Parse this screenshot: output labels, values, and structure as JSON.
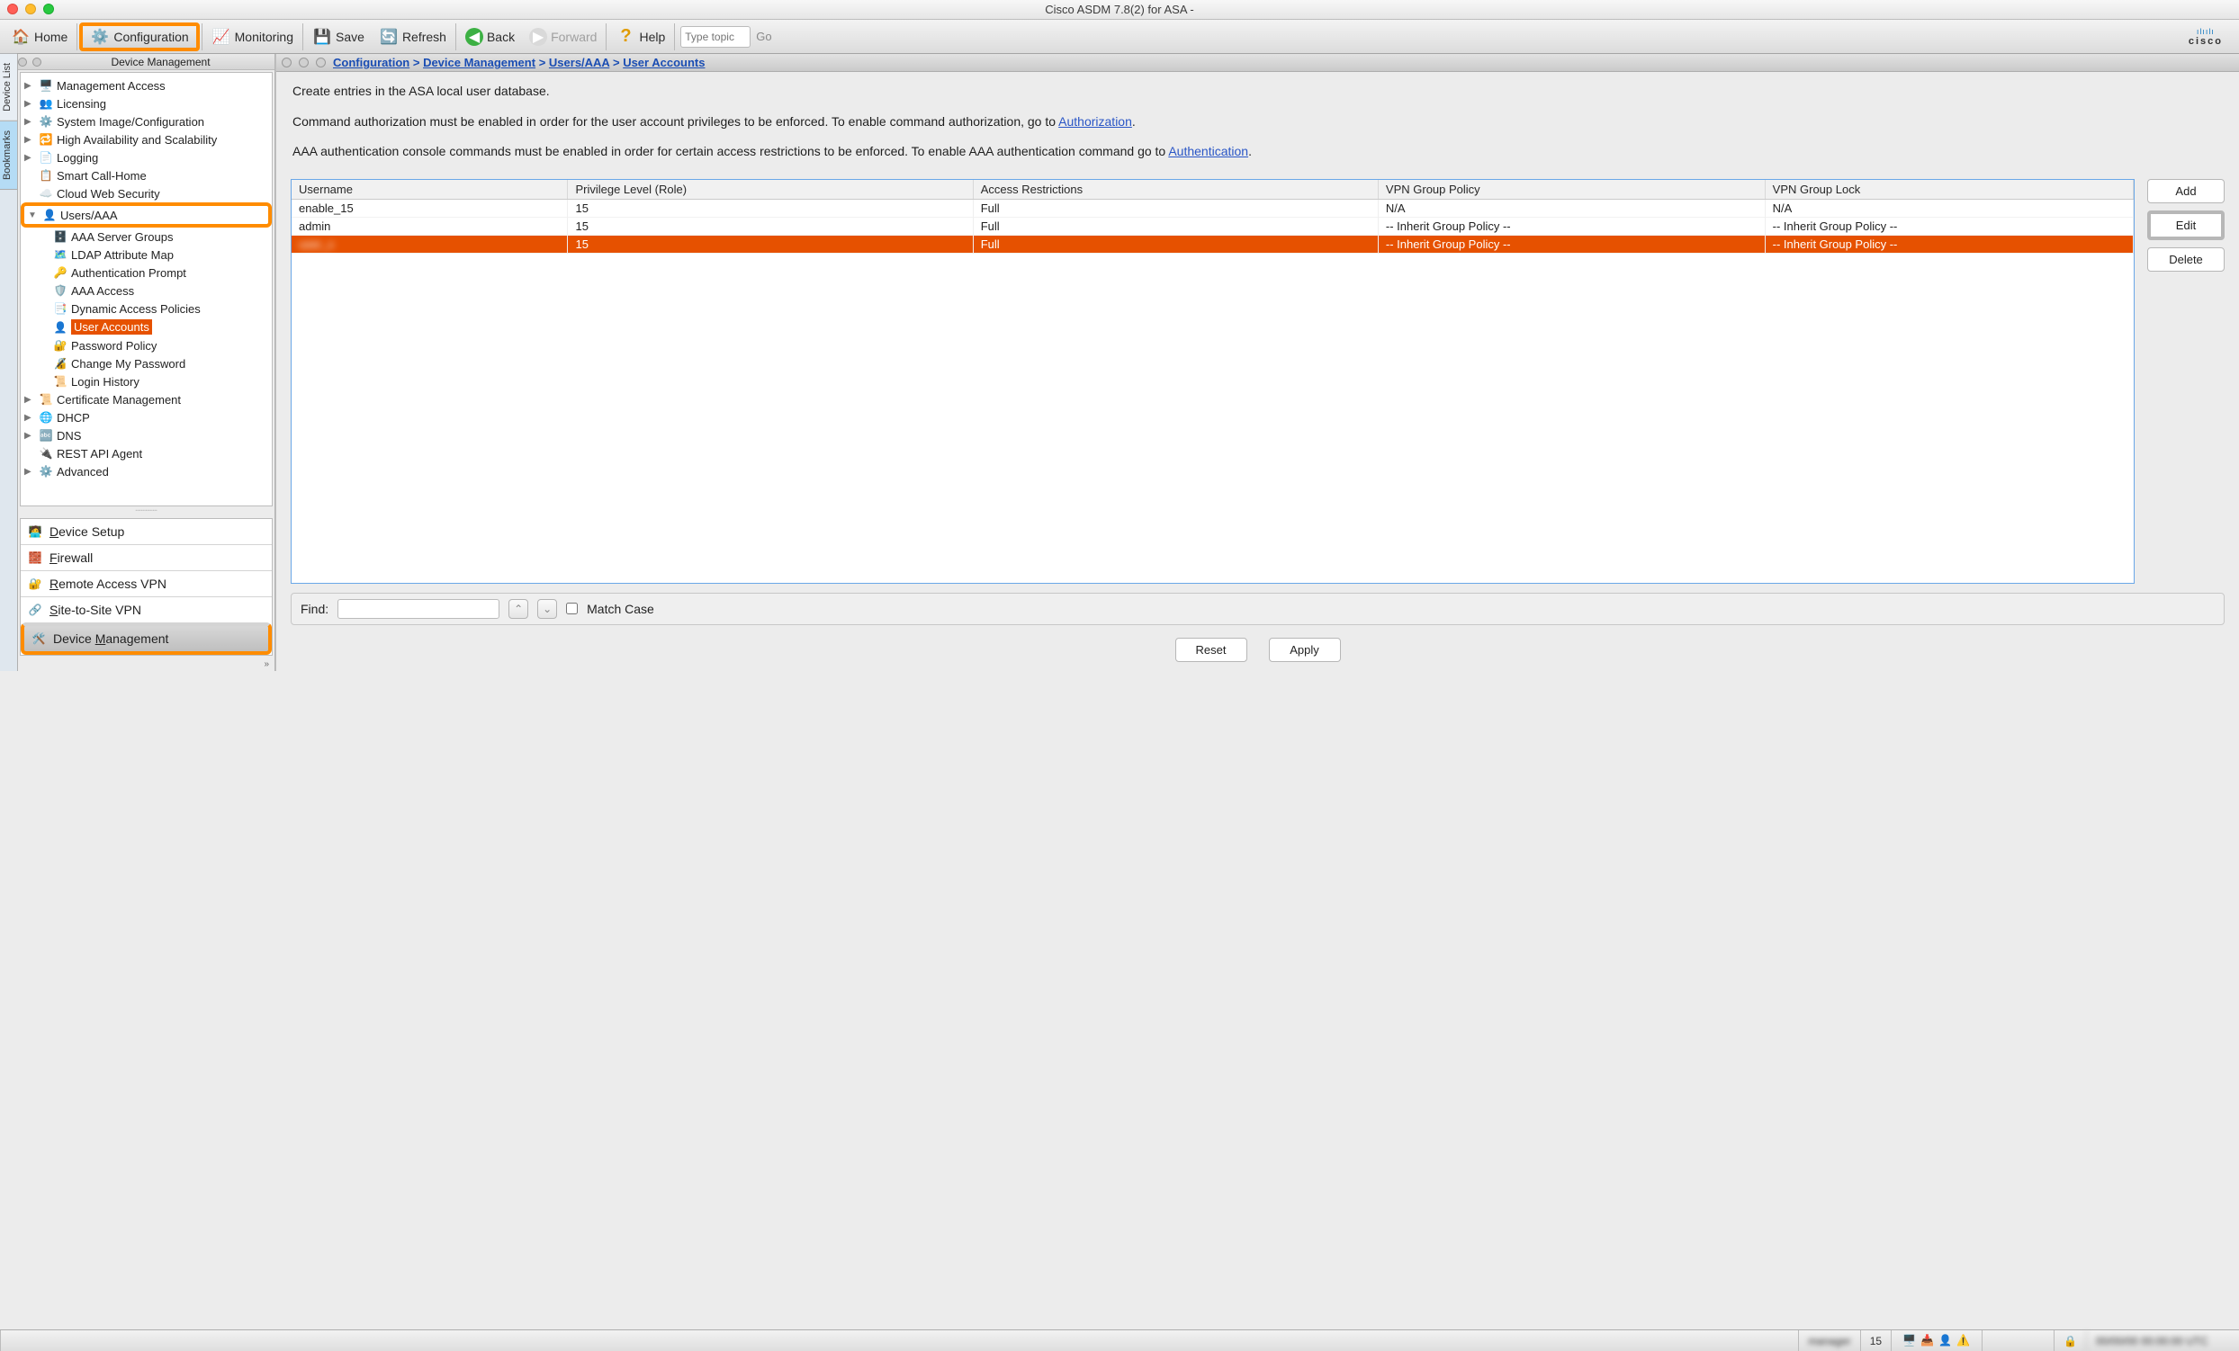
{
  "window": {
    "title_prefix": "Cisco ASDM 7.8(2) for ASA - ",
    "title_masked": "      "
  },
  "toolbar": {
    "home": "Home",
    "configuration": "Configuration",
    "monitoring": "Monitoring",
    "save": "Save",
    "refresh": "Refresh",
    "back": "Back",
    "forward": "Forward",
    "help": "Help",
    "search_placeholder": "Type topic",
    "go": "Go",
    "brand": "cisco"
  },
  "siderail": {
    "device_list": "Device List",
    "bookmarks": "Bookmarks"
  },
  "side": {
    "header": "Device Management",
    "tree": {
      "mgmt_access": "Management Access",
      "licensing": "Licensing",
      "sys_img": "System Image/Configuration",
      "ha": "High Availability and Scalability",
      "logging": "Logging",
      "smart_call": "Smart Call-Home",
      "cloud_web": "Cloud Web Security",
      "users_aaa": "Users/AAA",
      "aaa_server_groups": "AAA Server Groups",
      "ldap_attr": "LDAP Attribute Map",
      "auth_prompt": "Authentication Prompt",
      "aaa_access": "AAA Access",
      "dyn_access": "Dynamic Access Policies",
      "user_accounts": "User Accounts",
      "pwd_policy": "Password Policy",
      "change_pwd": "Change My Password",
      "login_hist": "Login History",
      "cert_mgmt": "Certificate Management",
      "dhcp": "DHCP",
      "dns": "DNS",
      "rest_api": "REST API Agent",
      "advanced": "Advanced"
    },
    "nav": {
      "device_setup": "Device Setup",
      "firewall": "Firewall",
      "remote_vpn": "Remote Access VPN",
      "site_vpn": "Site-to-Site VPN",
      "device_mgmt": "Device Management"
    }
  },
  "breadcrumb": {
    "configuration": "Configuration",
    "device_mgmt": "Device Management",
    "users_aaa": "Users/AAA",
    "user_accounts": "User Accounts"
  },
  "desc": {
    "p1": "Create entries in the ASA local user database.",
    "p2a": "Command authorization must be enabled in order for the user account privileges to be enforced. To enable command authorization, go to ",
    "p2link": "Authorization",
    "p3a": "AAA authentication console commands must be enabled in order for certain access restrictions to be enforced. To enable AAA authentication command go to ",
    "p3link": "Authentication"
  },
  "table": {
    "headers": {
      "username": "Username",
      "priv": "Privilege Level (Role)",
      "access": "Access Restrictions",
      "vpn_policy": "VPN Group Policy",
      "vpn_lock": "VPN Group Lock"
    },
    "rows": [
      {
        "username": "enable_15",
        "priv": "15",
        "access": "Full",
        "vpn_policy": "N/A",
        "vpn_lock": "N/A"
      },
      {
        "username": "admin",
        "priv": "15",
        "access": "Full",
        "vpn_policy": "-- Inherit Group Policy --",
        "vpn_lock": "-- Inherit Group Policy --"
      },
      {
        "username": "user_x",
        "priv": "15",
        "access": "Full",
        "vpn_policy": "-- Inherit Group Policy --",
        "vpn_lock": "-- Inherit Group Policy --"
      }
    ],
    "buttons": {
      "add": "Add",
      "edit": "Edit",
      "delete": "Delete"
    }
  },
  "find": {
    "label": "Find:",
    "match_case": "Match Case"
  },
  "actions": {
    "reset": "Reset",
    "apply": "Apply"
  },
  "status": {
    "user": "manager",
    "priv": "15"
  }
}
